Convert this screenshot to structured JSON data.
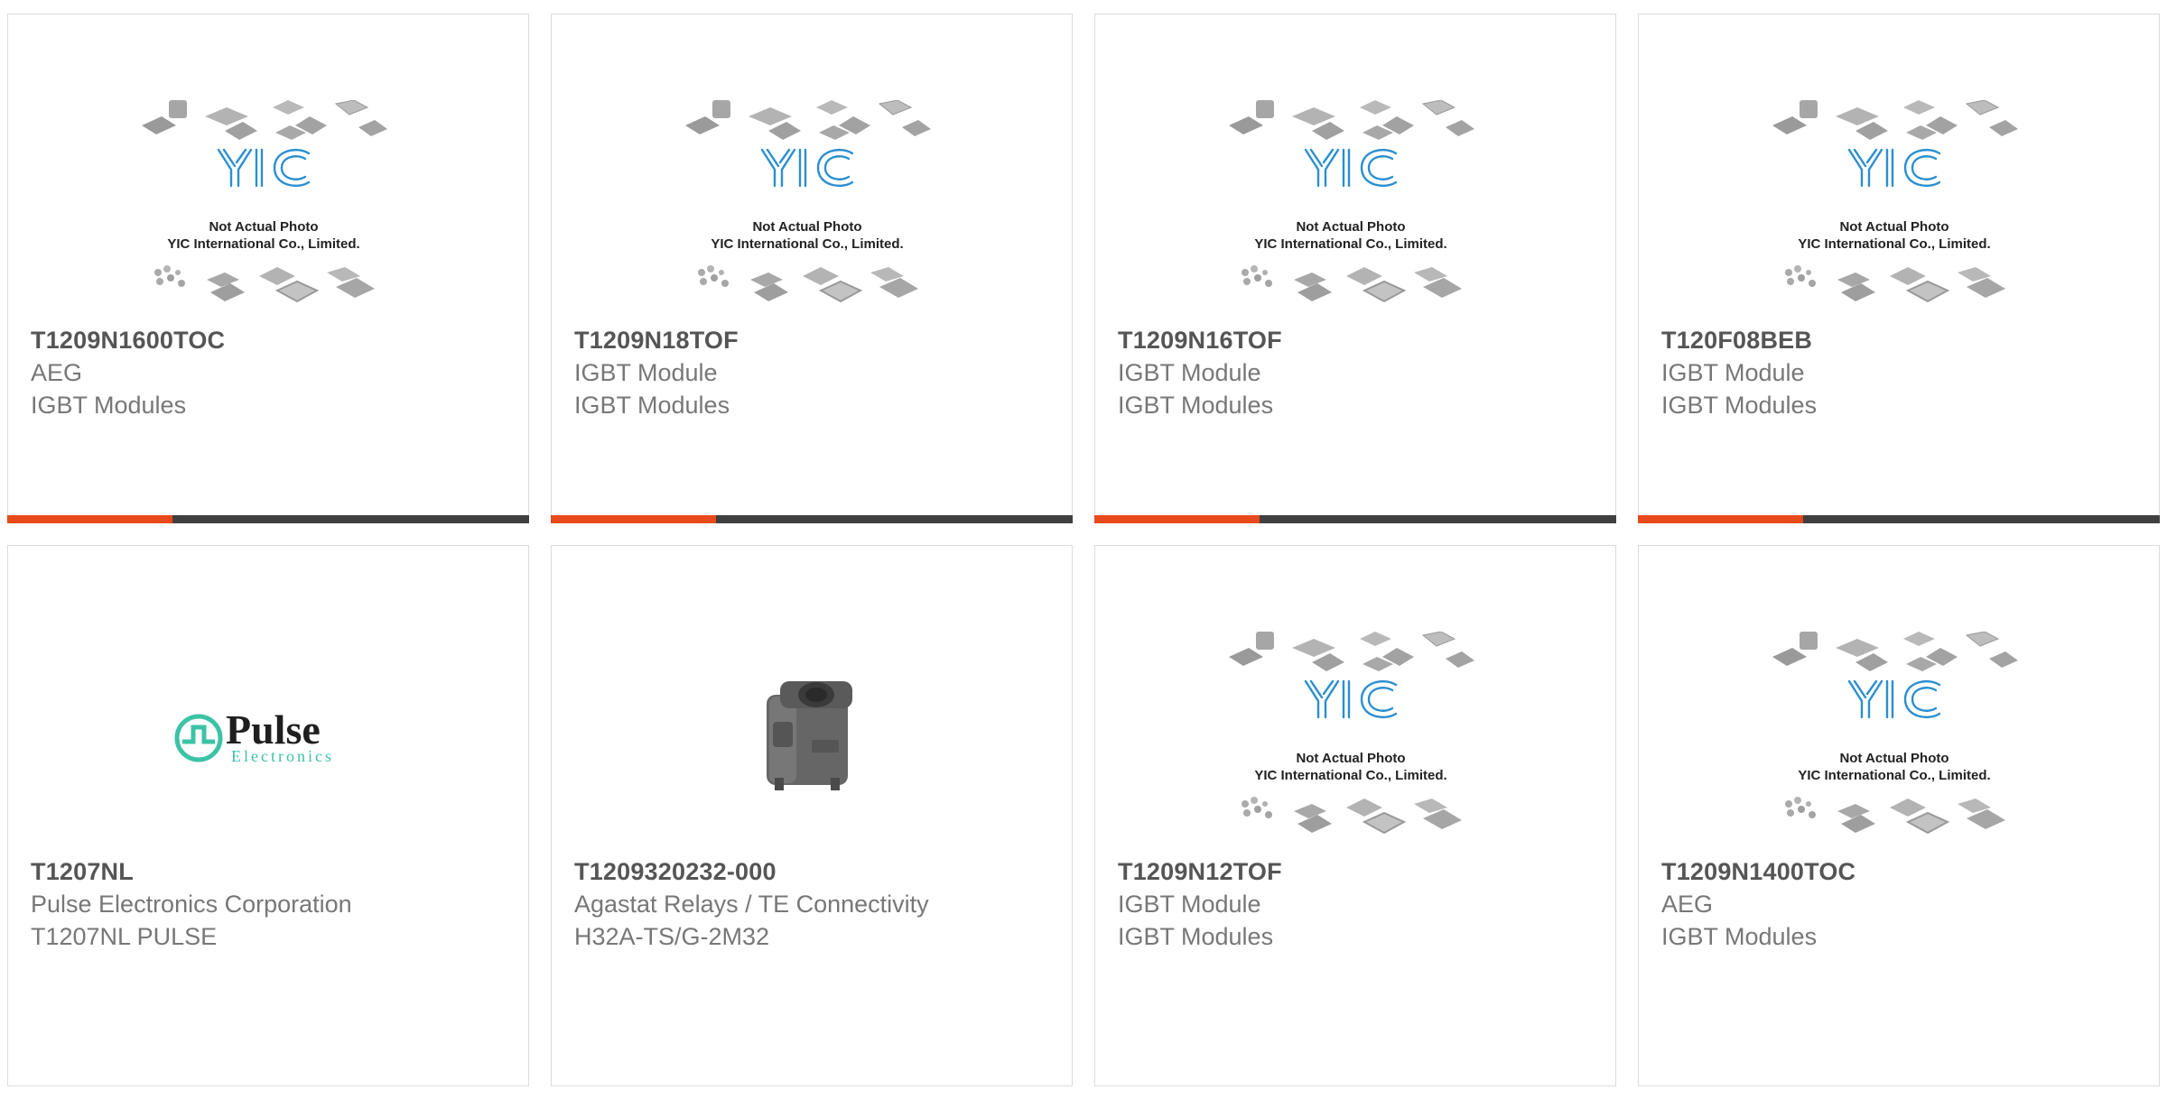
{
  "brand_colors": {
    "accent": "#e84a1c",
    "bar": "#404040",
    "yic_blue": "#2a8fd0",
    "pulse_green": "#3cc3a6"
  },
  "placeholder_image": {
    "line1": "Not Actual Photo",
    "line2": "YIC International Co., Limited."
  },
  "rows": [
    [
      {
        "part": "T1209N1600TOC",
        "maker": "AEG",
        "desc": "IGBT Modules",
        "image": "yic-placeholder-icon"
      },
      {
        "part": "T1209N18TOF",
        "maker": "IGBT Module",
        "desc": "IGBT Modules",
        "image": "yic-placeholder-icon"
      },
      {
        "part": "T1209N16TOF",
        "maker": "IGBT Module",
        "desc": "IGBT Modules",
        "image": "yic-placeholder-icon"
      },
      {
        "part": "T120F08BEB",
        "maker": "IGBT Module",
        "desc": "IGBT Modules",
        "image": "yic-placeholder-icon"
      }
    ],
    [
      {
        "part": "T1207NL",
        "maker": "Pulse Electronics Corporation",
        "desc": "T1207NL PULSE",
        "image": "pulse-electronics-logo"
      },
      {
        "part": "T1209320232-000",
        "maker": "Agastat Relays / TE Connectivity",
        "desc": "H32A-TS/G-2M32",
        "image": "connector-housing-photo"
      },
      {
        "part": "T1209N12TOF",
        "maker": "IGBT Module",
        "desc": "IGBT Modules",
        "image": "yic-placeholder-icon"
      },
      {
        "part": "T1209N1400TOC",
        "maker": "AEG",
        "desc": "IGBT Modules",
        "image": "yic-placeholder-icon"
      }
    ]
  ],
  "pulse_logo": {
    "name": "Pulse",
    "sub": "Electronics"
  }
}
